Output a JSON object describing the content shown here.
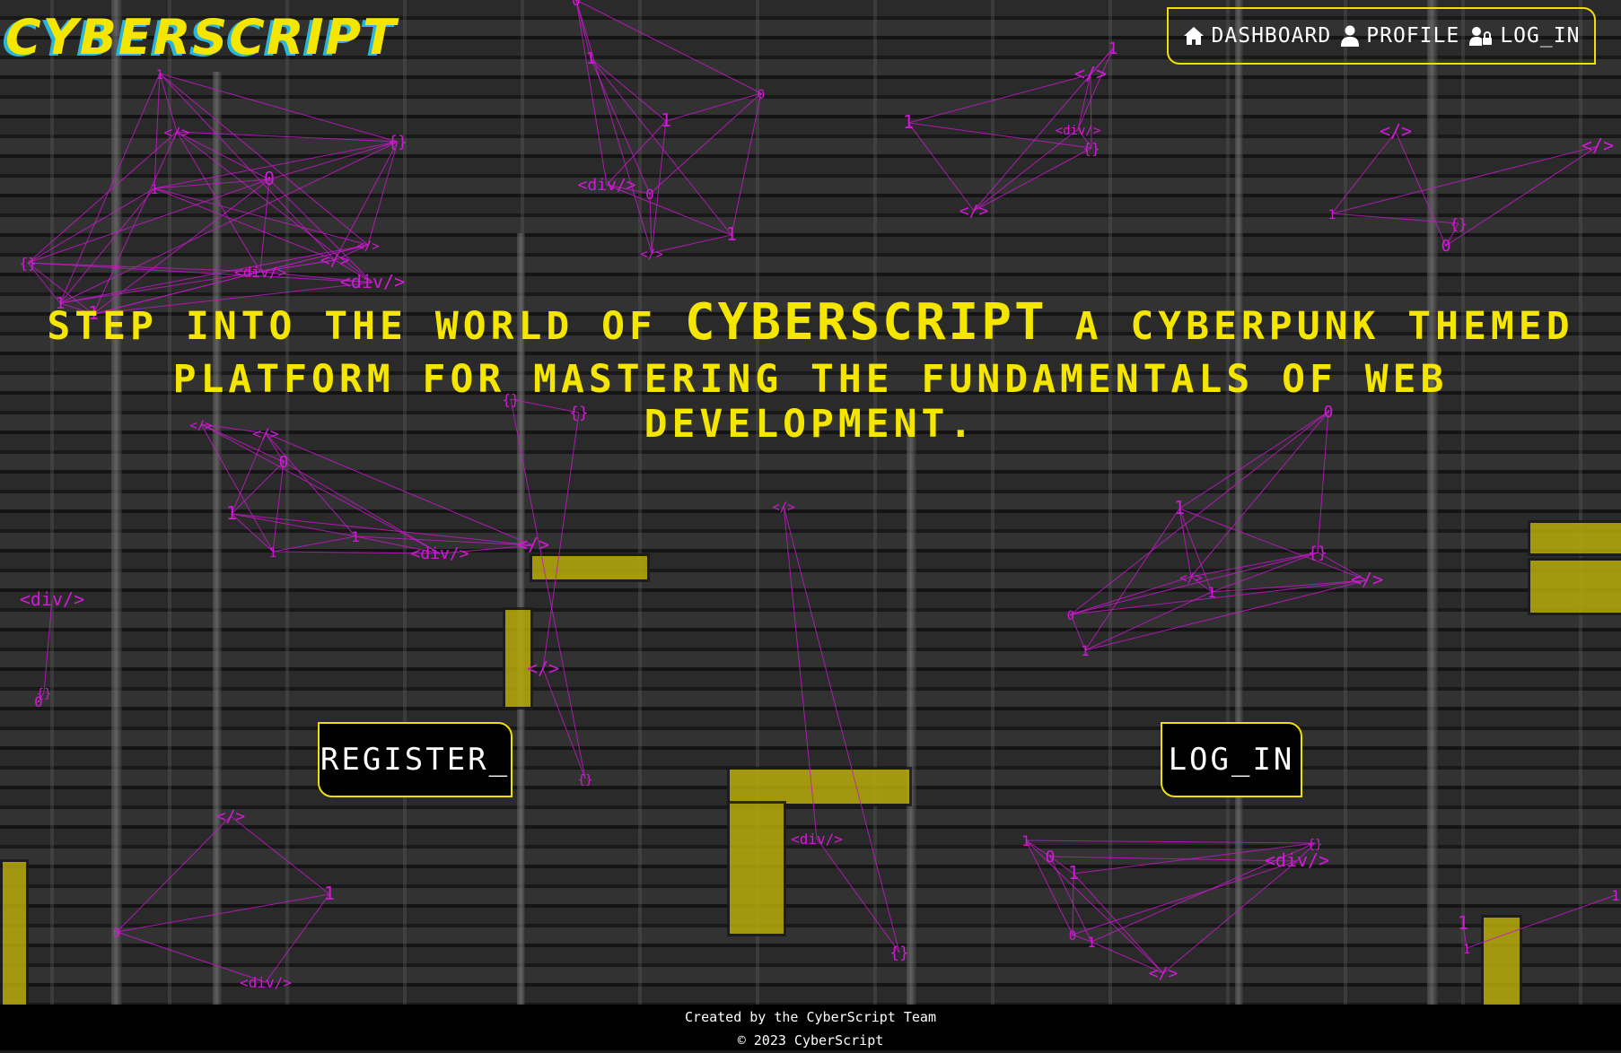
{
  "app": {
    "logo": "CYBERSCRIPT"
  },
  "nav": {
    "items": [
      {
        "label": "DASHBOARD",
        "icon": "home-icon"
      },
      {
        "label": "PROFILE",
        "icon": "user-icon"
      },
      {
        "label": "LOG_IN",
        "icon": "user-lock-icon"
      }
    ]
  },
  "hero": {
    "line1_pre": "STEP INTO THE WORLD OF ",
    "brand": "CYBERSCRIPT",
    "line1_post": " A CYBERPUNK THEMED",
    "line2": "PLATFORM FOR MASTERING THE FUNDAMENTALS OF WEB DEVELOPMENT."
  },
  "actions": {
    "register": "REGISTER_",
    "login": "LOG_IN"
  },
  "footer": {
    "credit": "Created by the CyberScript Team",
    "copyright": "© 2023 CyberScript"
  },
  "colors": {
    "accent": "#f5e600",
    "logo_shadow": "#2bb5d8",
    "network": "#d21bd6",
    "footer_bg": "#000000"
  },
  "background_network_glyphs": [
    "</>",
    "{}",
    "<div/>",
    "0",
    "1"
  ]
}
